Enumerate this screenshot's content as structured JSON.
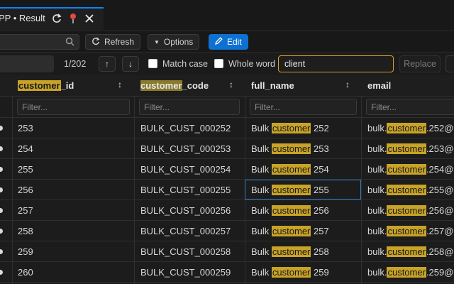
{
  "tab": {
    "title": "PP • Result"
  },
  "toolbar": {
    "refresh_label": "Refresh",
    "options_label": "Options",
    "edit_label": "Edit"
  },
  "find": {
    "count": "1/202",
    "match_case_label": "Match case",
    "whole_word_label": "Whole word",
    "query": "client",
    "replace_label": "Replace"
  },
  "columns": [
    {
      "prefix": "customer",
      "suffix": "_id",
      "filter_placeholder": "Filter..."
    },
    {
      "prefix": "customer",
      "suffix": "_code",
      "filter_placeholder": "Filter..."
    },
    {
      "prefix": "",
      "suffix": "full_name",
      "filter_placeholder": "Filter..."
    },
    {
      "prefix": "",
      "suffix": "email",
      "filter_placeholder": "Filter..."
    }
  ],
  "rows": [
    {
      "id": "253",
      "code": "BULK_CUST_000252",
      "name_a": "Bulk",
      "name_hl": "customer",
      "name_b": "252",
      "email_a": "bulk.",
      "email_hl": "customer",
      "email_b": ".252@"
    },
    {
      "id": "254",
      "code": "BULK_CUST_000253",
      "name_a": "Bulk",
      "name_hl": "customer",
      "name_b": "253",
      "email_a": "bulk.",
      "email_hl": "customer",
      "email_b": ".253@"
    },
    {
      "id": "255",
      "code": "BULK_CUST_000254",
      "name_a": "Bulk",
      "name_hl": "customer",
      "name_b": "254",
      "email_a": "bulk.",
      "email_hl": "customer",
      "email_b": ".254@"
    },
    {
      "id": "256",
      "code": "BULK_CUST_000255",
      "name_a": "Bulk",
      "name_hl": "customer",
      "name_b": "255",
      "email_a": "bulk.",
      "email_hl": "customer",
      "email_b": ".255@"
    },
    {
      "id": "257",
      "code": "BULK_CUST_000256",
      "name_a": "Bulk",
      "name_hl": "customer",
      "name_b": "256",
      "email_a": "bulk.",
      "email_hl": "customer",
      "email_b": ".256@"
    },
    {
      "id": "258",
      "code": "BULK_CUST_000257",
      "name_a": "Bulk",
      "name_hl": "customer",
      "name_b": "257",
      "email_a": "bulk.",
      "email_hl": "customer",
      "email_b": ".257@"
    },
    {
      "id": "259",
      "code": "BULK_CUST_000258",
      "name_a": "Bulk",
      "name_hl": "customer",
      "name_b": "258",
      "email_a": "bulk.",
      "email_hl": "customer",
      "email_b": ".258@"
    },
    {
      "id": "260",
      "code": "BULK_CUST_000259",
      "name_a": "Bulk",
      "name_hl": "customer",
      "name_b": "259",
      "email_a": "bulk.",
      "email_hl": "customer",
      "email_b": ".259@"
    }
  ],
  "colors": {
    "accent": "#0e71d1",
    "highlight": "#c8a327",
    "find_border": "#d7a42a",
    "tab_top": "#0a84ff"
  },
  "icons": {
    "refresh": "refresh-icon",
    "pin": "pin-icon",
    "close": "close-icon",
    "search": "search-icon",
    "edit": "pencil-icon"
  }
}
